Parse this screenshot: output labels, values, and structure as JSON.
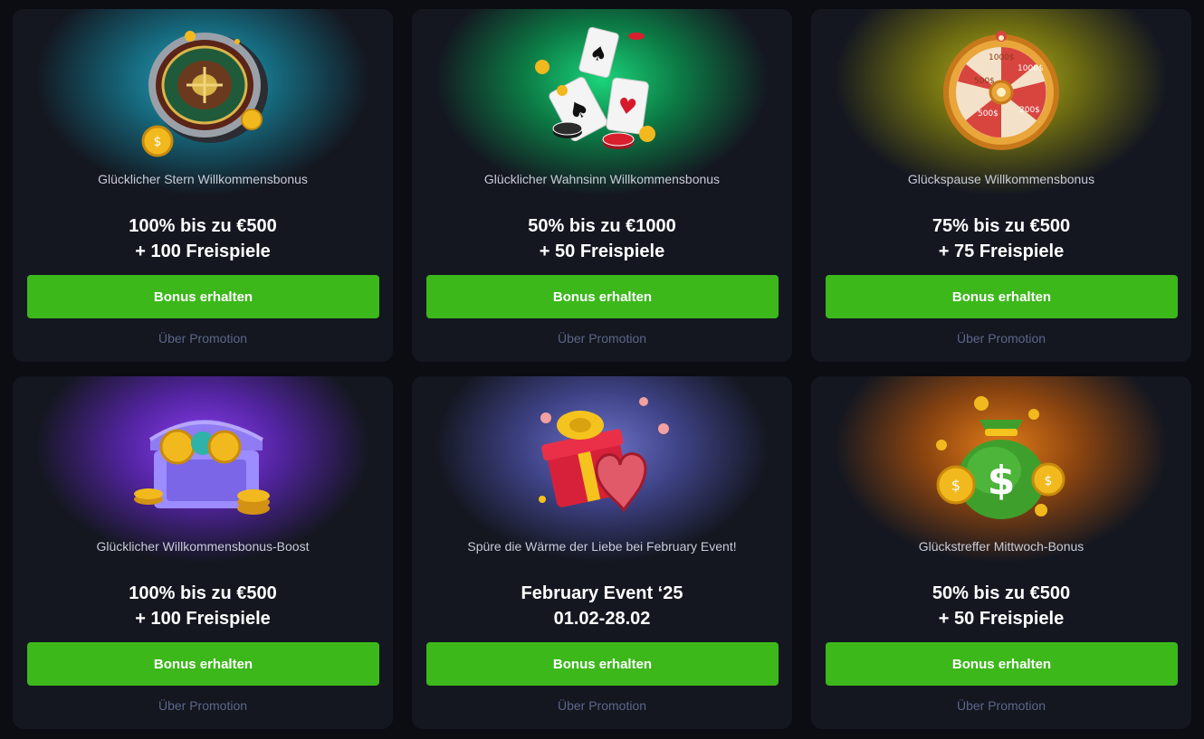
{
  "cards": [
    {
      "subtitle": "Glücklicher Stern Willkommensbonus",
      "line1": "100% bis zu €500",
      "line2": "+ 100 Freispiele",
      "button": "Bonus erhalten",
      "link": "Über Promotion",
      "illustration": "roulette-wheel-icon"
    },
    {
      "subtitle": "Glücklicher Wahnsinn Willkommensbonus",
      "line1": "50% bis zu €1000",
      "line2": "+ 50 Freispiele",
      "button": "Bonus erhalten",
      "link": "Über Promotion",
      "illustration": "playing-cards-icon"
    },
    {
      "subtitle": "Glückspause Willkommensbonus",
      "line1": "75% bis zu €500",
      "line2": "+ 75 Freispiele",
      "button": "Bonus erhalten",
      "link": "Über Promotion",
      "illustration": "fortune-wheel-icon",
      "wheel_labels": [
        "1000$",
        "500$",
        "200$",
        "500$",
        "1000$"
      ]
    },
    {
      "subtitle": "Glücklicher Willkommensbonus-Boost",
      "line1": "100% bis zu €500",
      "line2": "+ 100 Freispiele",
      "button": "Bonus erhalten",
      "link": "Über Promotion",
      "illustration": "treasure-chest-icon"
    },
    {
      "subtitle": "Spüre die Wärme der Liebe bei February Event!",
      "line1": "February Event ‘25",
      "line2": "01.02-28.02",
      "button": "Bonus erhalten",
      "link": "Über Promotion",
      "illustration": "gift-heart-icon"
    },
    {
      "subtitle": "Glückstreffer Mittwoch-Bonus",
      "line1": "50% bis zu €500",
      "line2": "+ 50 Freispiele",
      "button": "Bonus erhalten",
      "link": "Über Promotion",
      "illustration": "money-bag-icon"
    }
  ],
  "colors": {
    "page_bg": "#0b0d13",
    "card_bg": "#141720",
    "button": "#3cb81b",
    "link": "#5c6688"
  }
}
